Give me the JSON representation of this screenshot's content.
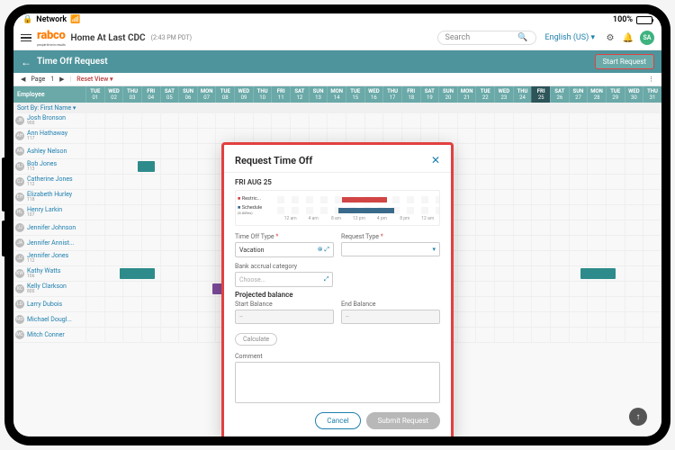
{
  "statusbar": {
    "network": "Network",
    "battery": "100%"
  },
  "appbar": {
    "brand": "rabco",
    "tagline": "people time in results",
    "location": "Home At Last CDC",
    "time": "(2:43 PM PDT)",
    "search_placeholder": "Search",
    "language": "English (US)",
    "avatar": "SA"
  },
  "page": {
    "title": "Time Off Request",
    "start_button": "Start Request",
    "page_label": "Page",
    "page_num": "1",
    "sort_label": "Sort By:",
    "sort_value": "First Name",
    "employee_col": "Employee"
  },
  "days": [
    {
      "dow": "TUE",
      "num": "01"
    },
    {
      "dow": "WED",
      "num": "02"
    },
    {
      "dow": "THU",
      "num": "03"
    },
    {
      "dow": "FRI",
      "num": "04"
    },
    {
      "dow": "SAT",
      "num": "05"
    },
    {
      "dow": "SUN",
      "num": "06"
    },
    {
      "dow": "MON",
      "num": "07"
    },
    {
      "dow": "TUE",
      "num": "08"
    },
    {
      "dow": "WED",
      "num": "09"
    },
    {
      "dow": "THU",
      "num": "10"
    },
    {
      "dow": "FRI",
      "num": "11"
    },
    {
      "dow": "SAT",
      "num": "12"
    },
    {
      "dow": "SUN",
      "num": "13"
    },
    {
      "dow": "MON",
      "num": "14"
    },
    {
      "dow": "TUE",
      "num": "15"
    },
    {
      "dow": "WED",
      "num": "16"
    },
    {
      "dow": "THU",
      "num": "17"
    },
    {
      "dow": "FRI",
      "num": "18"
    },
    {
      "dow": "SAT",
      "num": "19"
    },
    {
      "dow": "SUN",
      "num": "20"
    },
    {
      "dow": "MON",
      "num": "21"
    },
    {
      "dow": "TUE",
      "num": "22"
    },
    {
      "dow": "WED",
      "num": "23"
    },
    {
      "dow": "THU",
      "num": "24"
    },
    {
      "dow": "FRI",
      "num": "25",
      "today": true
    },
    {
      "dow": "SAT",
      "num": "26"
    },
    {
      "dow": "SUN",
      "num": "27"
    },
    {
      "dow": "MON",
      "num": "28"
    },
    {
      "dow": "TUE",
      "num": "29"
    },
    {
      "dow": "WED",
      "num": "30"
    },
    {
      "dow": "THU",
      "num": "31"
    }
  ],
  "employees": [
    {
      "name": "Josh Bronson",
      "id": "900",
      "av": "JB"
    },
    {
      "name": "Ann Hathaway",
      "id": "117",
      "av": "AH"
    },
    {
      "name": "Ashley Nelson",
      "id": "",
      "av": "AN"
    },
    {
      "name": "Bob Jones",
      "id": "113",
      "av": "BJ"
    },
    {
      "name": "Catherine Jones",
      "id": "112",
      "av": "CJ"
    },
    {
      "name": "Elizabeth Hurley",
      "id": "118",
      "av": "EH"
    },
    {
      "name": "Henry Larkin",
      "id": "107",
      "av": "HL"
    },
    {
      "name": "Jennifer Johnson",
      "id": "",
      "av": "JJ"
    },
    {
      "name": "Jennifer Annist...",
      "id": "",
      "av": "JA"
    },
    {
      "name": "Jennifer Jones",
      "id": "112",
      "av": "JJ"
    },
    {
      "name": "Kathy Watts",
      "id": "106",
      "av": "KW"
    },
    {
      "name": "Kelly Clarkson",
      "id": "800",
      "av": "KC"
    },
    {
      "name": "Larry Dubois",
      "id": "",
      "av": "LD"
    },
    {
      "name": "Michael Dougl...",
      "id": "",
      "av": "MD"
    },
    {
      "name": "Mitch Conner",
      "id": "",
      "av": "MC"
    }
  ],
  "modal": {
    "title": "Request Time Off",
    "date": "FRI AUG 25",
    "restrict_label": "Restric...",
    "schedule_label": "Schedule",
    "schedule_hours": "(8.00hrs)",
    "ticks": [
      "12 am",
      "4 am",
      "8 am",
      "12 pm",
      "4 pm",
      "8 pm",
      "12 am"
    ],
    "time_off_type_label": "Time Off Type",
    "time_off_type_value": "Vacation",
    "request_type_label": "Request Type",
    "request_type_value": "",
    "bank_label": "Bank accrual category",
    "bank_placeholder": "Choose...",
    "projected_title": "Projected balance",
    "start_balance_label": "Start Balance",
    "start_balance_value": "--",
    "end_balance_label": "End Balance",
    "end_balance_value": "--",
    "calculate": "Calculate",
    "comment_label": "Comment",
    "cancel": "Cancel",
    "submit": "Submit Request"
  }
}
